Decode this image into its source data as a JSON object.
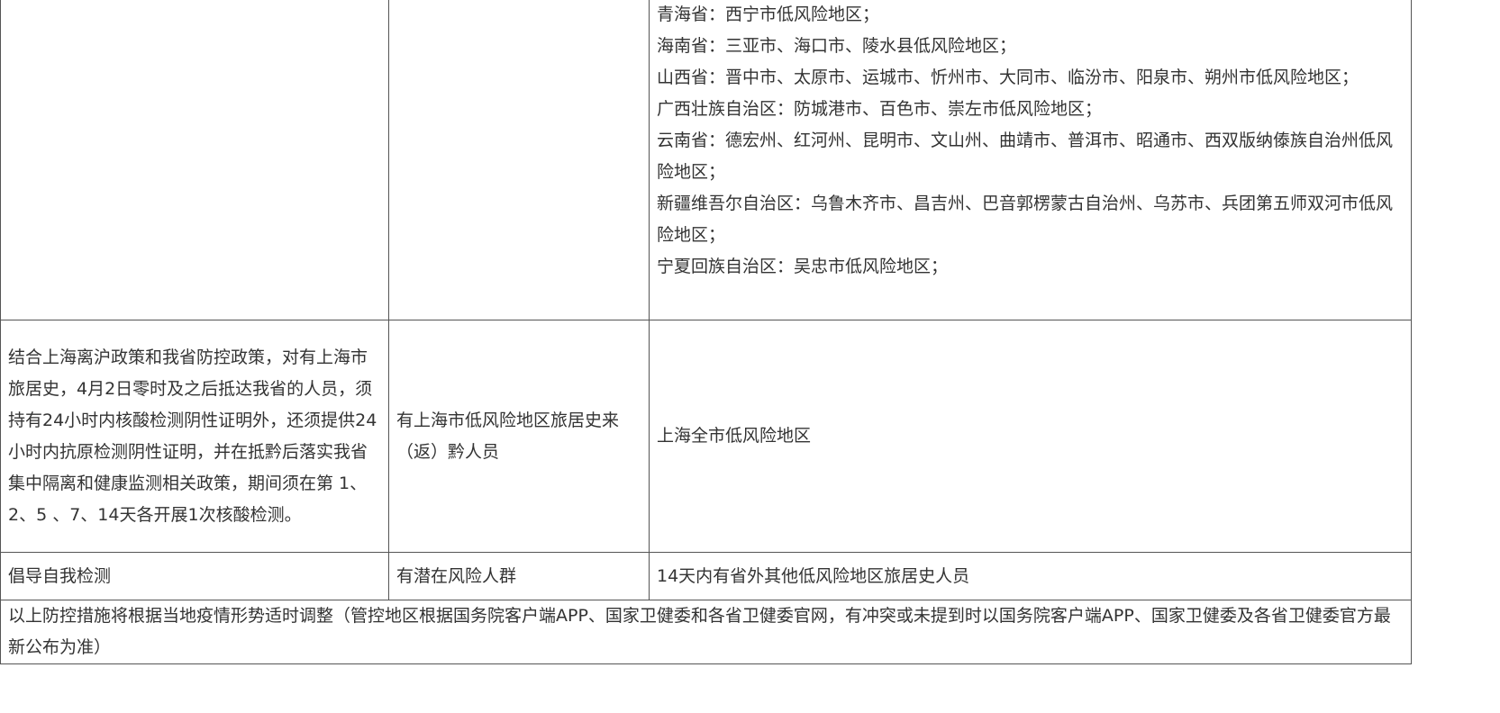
{
  "regions_row": {
    "col1": "",
    "col2": "",
    "lines": [
      "青海省：西宁市低风险地区；",
      "海南省：三亚市、海口市、陵水县低风险地区；",
      "山西省：晋中市、太原市、运城市、忻州市、大同市、临汾市、阳泉市、朔州市低风险地区；",
      "广西壮族自治区：防城港市、百色市、崇左市低风险地区；",
      "云南省：德宏州、红河州、昆明市、文山州、曲靖市、普洱市、昭通市、西双版纳傣族自治州低风险地区；",
      "新疆维吾尔自治区：乌鲁木齐市、昌吉州、巴音郭楞蒙古自治州、乌苏市、兵团第五师双河市低风险地区；",
      "宁夏回族自治区：吴忠市低风险地区；"
    ]
  },
  "shanghai_row": {
    "measures": "结合上海离沪政策和我省防控政策，对有上海市旅居史，4月2日零时及之后抵达我省的人员，须持有24小时内核酸检测阴性证明外，还须提供24小时内抗原检测阴性证明，并在抵黔后落实我省集中隔离和健康监测相关政策，期间须在第 1、2、5 、7、14天各开展1次核酸检测。",
    "people": "有上海市低风险地区旅居史来（返）黔人员",
    "area": "上海全市低风险地区"
  },
  "self_test_row": {
    "measures": "倡导自我检测",
    "people": "有潜在风险人群",
    "area": "14天内有省外其他低风险地区旅居史人员"
  },
  "footer_note": "以上防控措施将根据当地疫情形势适时调整（管控地区根据国务院客户端APP、国家卫健委和各省卫健委官网，有冲突或未提到时以国务院客户端APP、国家卫健委及各省卫健委官方最新公布为准）"
}
